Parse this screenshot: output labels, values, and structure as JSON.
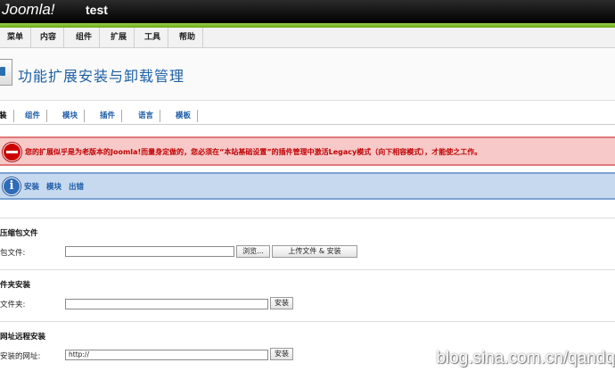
{
  "header": {
    "logo": "Joomla!",
    "site_name": "test"
  },
  "menu": [
    "菜单",
    "内容",
    "组件",
    "扩展",
    "工具",
    "帮助"
  ],
  "page_title": "功能扩展安装与卸载管理",
  "subtabs": [
    "装",
    "组件",
    "模块",
    "插件",
    "语言",
    "模板"
  ],
  "error_message": "您的扩展似乎是为老版本的Joomla!而量身定做的，您必须在“本站基础设置”的插件管理中激活Legacy模式（向下相容模式），才能使之工作。",
  "info_links": [
    "安装",
    "模块",
    "出错"
  ],
  "upload": {
    "title": "压缩包文件",
    "label": "包文件:",
    "browse_label": "浏览...",
    "button": "上传文件 & 安装"
  },
  "folder": {
    "title": "件夹安装",
    "label": "文件夹:",
    "button": "安装"
  },
  "url": {
    "title": "网址远程安装",
    "label": "安装的网址:",
    "value": "http://",
    "button": "安装"
  },
  "watermark": "blog.sina.com.cn/qandq"
}
